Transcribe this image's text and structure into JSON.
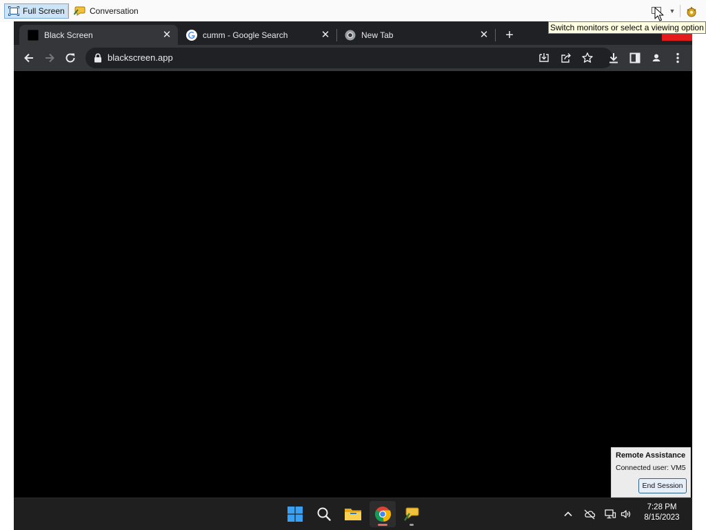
{
  "host_toolbar": {
    "fullscreen_label": "Full Screen",
    "conversation_label": "Conversation",
    "tooltip": "Switch monitors or select a viewing option"
  },
  "icons": {
    "fullscreen": "fullscreen-icon",
    "conversation": "chat-icon",
    "monitor": "monitor-icon",
    "dropdown": "chevron-down-icon",
    "settings": "settings-icon"
  },
  "browser": {
    "tabs": [
      {
        "title": "Black Screen",
        "favicon": "black-square-icon",
        "active": true
      },
      {
        "title": "cumm - Google Search",
        "favicon": "google-icon",
        "active": false
      },
      {
        "title": "New Tab",
        "favicon": "chrome-icon",
        "active": false
      }
    ],
    "url": "blackscreen.app"
  },
  "remote_assistance": {
    "title": "Remote Assistance",
    "connected_user": "Connected user:  VM5",
    "end_session_label": "End Session"
  },
  "taskbar": {
    "apps": [
      "start-icon",
      "search-icon",
      "file-explorer-icon",
      "chrome-icon",
      "remote-assistance-icon"
    ],
    "tray": [
      "chevron-up-icon",
      "onedrive-offline-icon",
      "network-icon",
      "volume-icon"
    ],
    "time": "7:28 PM",
    "date": "8/15/2023"
  },
  "colors": {
    "accent": "#cde4f7",
    "chrome_dark": "#202124",
    "chrome_toolbar": "#35363a",
    "taskbar": "#1f1f1f",
    "alert_red": "#e41b1b"
  }
}
